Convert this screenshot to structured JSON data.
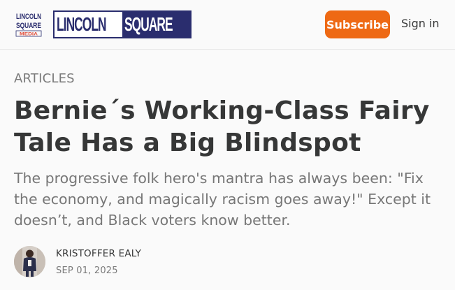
{
  "header": {
    "logo_small_lines": [
      "LINCOLN",
      "SQUARE",
      "MEDIA"
    ],
    "wordmark_left": "LINCOLN",
    "wordmark_right": "SQUARE",
    "subscribe_label": "Subscribe",
    "signin_label": "Sign in",
    "brand_color": "#2a2d6e",
    "accent_color": "#ee6914"
  },
  "article": {
    "section": "ARTICLES",
    "title": "Bernie´s Working-Class Fairy Tale Has a Big Blindspot",
    "subtitle": "The progressive folk hero's mantra has always been: \"Fix the economy, and magically racism goes away!\" Except it doesn’t, and Black voters know better.",
    "author": "KRISTOFFER EALY",
    "date": "SEP 01, 2025"
  }
}
